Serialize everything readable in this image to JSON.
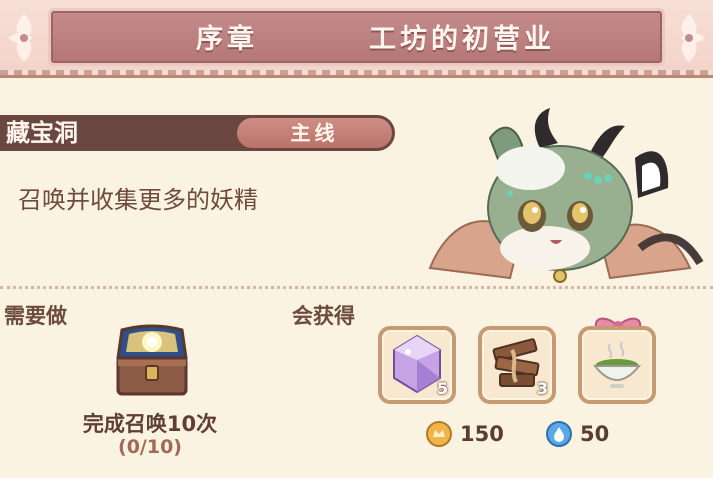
{
  "header": {
    "chapter": "序章",
    "title": "工坊的初营业"
  },
  "quest": {
    "name": "藏宝洞",
    "tag": "主线",
    "description": "召唤并收集更多的妖精"
  },
  "requirement": {
    "label": "需要做",
    "task": "完成召唤10次",
    "progress": "(0/10)",
    "icon": "treasure-chest-icon"
  },
  "rewards": {
    "label": "会获得",
    "items": [
      {
        "icon": "crystal-gem-icon",
        "count": "5"
      },
      {
        "icon": "wood-planks-rope-icon",
        "count": "3"
      },
      {
        "icon": "green-tea-bowl-icon",
        "count": ""
      }
    ],
    "currencies": [
      {
        "icon": "gold-coin-icon",
        "amount": "150"
      },
      {
        "icon": "water-drop-icon",
        "amount": "50"
      }
    ]
  },
  "colors": {
    "banner": "#b47777",
    "quest_bar": "#6b4741",
    "tag": "#c27f75",
    "background": "#fbf3e2"
  }
}
